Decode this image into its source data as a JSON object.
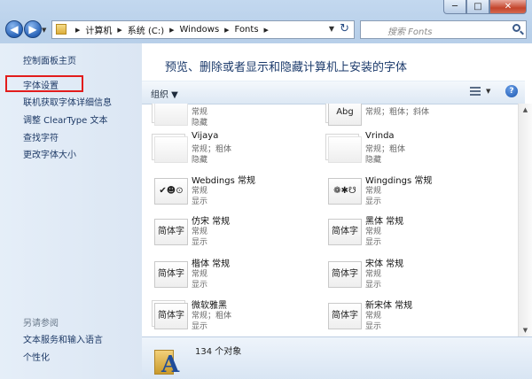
{
  "window": {
    "min_glyph": "─",
    "max_glyph": "□",
    "close_glyph": "✕"
  },
  "nav": {
    "back_glyph": "◀",
    "forward_glyph": "▶",
    "breadcrumb": [
      "计算机",
      "系统 (C:)",
      "Windows",
      "Fonts"
    ],
    "search_placeholder": "搜索 Fonts"
  },
  "left_pane": {
    "links": [
      "控制面板主页",
      "字体设置",
      "联机获取字体详细信息",
      "调整 ClearType 文本",
      "查找字符",
      "更改字体大小"
    ],
    "see_also_title": "另请参阅",
    "see_also": [
      "文本服务和输入语言",
      "个性化"
    ]
  },
  "main": {
    "headline": "预览、删除或者显示和隐藏计算机上安装的字体",
    "organize_label": "组织"
  },
  "fonts": [
    {
      "name": "",
      "style": "常规",
      "status": "隐藏",
      "sample": ""
    },
    {
      "name": "",
      "style": "常规；粗体；斜体",
      "status": "",
      "sample": "Abg"
    },
    {
      "name": "Vijaya",
      "style": "常规；粗体",
      "status": "隐藏",
      "sample": ""
    },
    {
      "name": "Vrinda",
      "style": "常规；粗体",
      "status": "隐藏",
      "sample": ""
    },
    {
      "name": "Webdings 常规",
      "style": "常规",
      "status": "显示",
      "sample": "✔☻⊙"
    },
    {
      "name": "Wingdings 常规",
      "style": "常规",
      "status": "显示",
      "sample": "❁✱☋"
    },
    {
      "name": "仿宋 常规",
      "style": "常规",
      "status": "显示",
      "sample": "简体字"
    },
    {
      "name": "黑体 常规",
      "style": "常规",
      "status": "显示",
      "sample": "简体字"
    },
    {
      "name": "楷体 常规",
      "style": "常规",
      "status": "显示",
      "sample": "简体字"
    },
    {
      "name": "宋体 常规",
      "style": "常规",
      "status": "显示",
      "sample": "简体字"
    },
    {
      "name": "微软雅黑",
      "style": "常规；粗体",
      "status": "显示",
      "sample": "简体字"
    },
    {
      "name": "新宋体 常规",
      "style": "常规",
      "status": "显示",
      "sample": "简体字"
    }
  ],
  "status": {
    "count": "134 个对象"
  }
}
